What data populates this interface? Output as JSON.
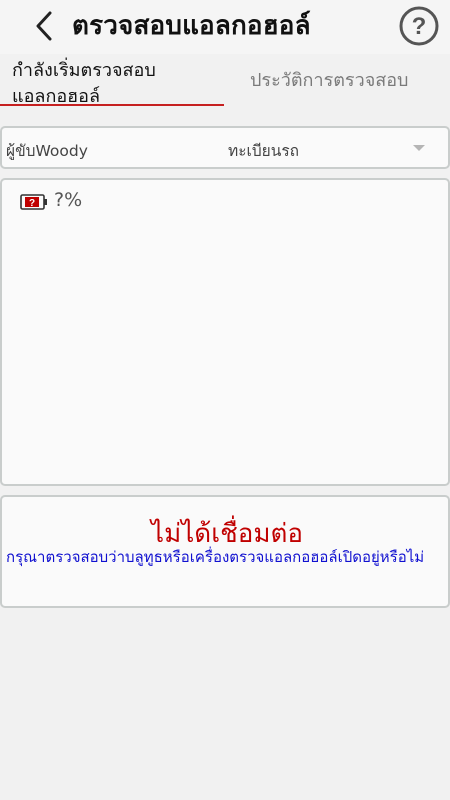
{
  "header": {
    "title": "ตรวจสอบแอลกอฮอล์",
    "back_icon": "chevron-left-icon",
    "help_icon": "question-circle-icon"
  },
  "tabs": [
    {
      "label": "กำลังเริ่มตรวจสอบแอลกอฮอล์",
      "active": true
    },
    {
      "label": "ประวัติการตรวจสอบ",
      "active": false
    }
  ],
  "selector": {
    "driver": "ผู้ขับWoody",
    "plate": "ทะเบียนรถ"
  },
  "reading": {
    "battery_icon": "battery-unknown-icon",
    "percent": "?%"
  },
  "status": {
    "title": "ไม่ได้เชื่อมต่อ",
    "message": "กรุณาตรวจสอบว่าบลูทูธหรือเครื่องตรวจแอลกอฮอล์เปิดอยู่หรือไม่"
  },
  "colors": {
    "accent_red": "#c62020",
    "status_red": "#c00000",
    "message_blue": "#1010d0"
  }
}
